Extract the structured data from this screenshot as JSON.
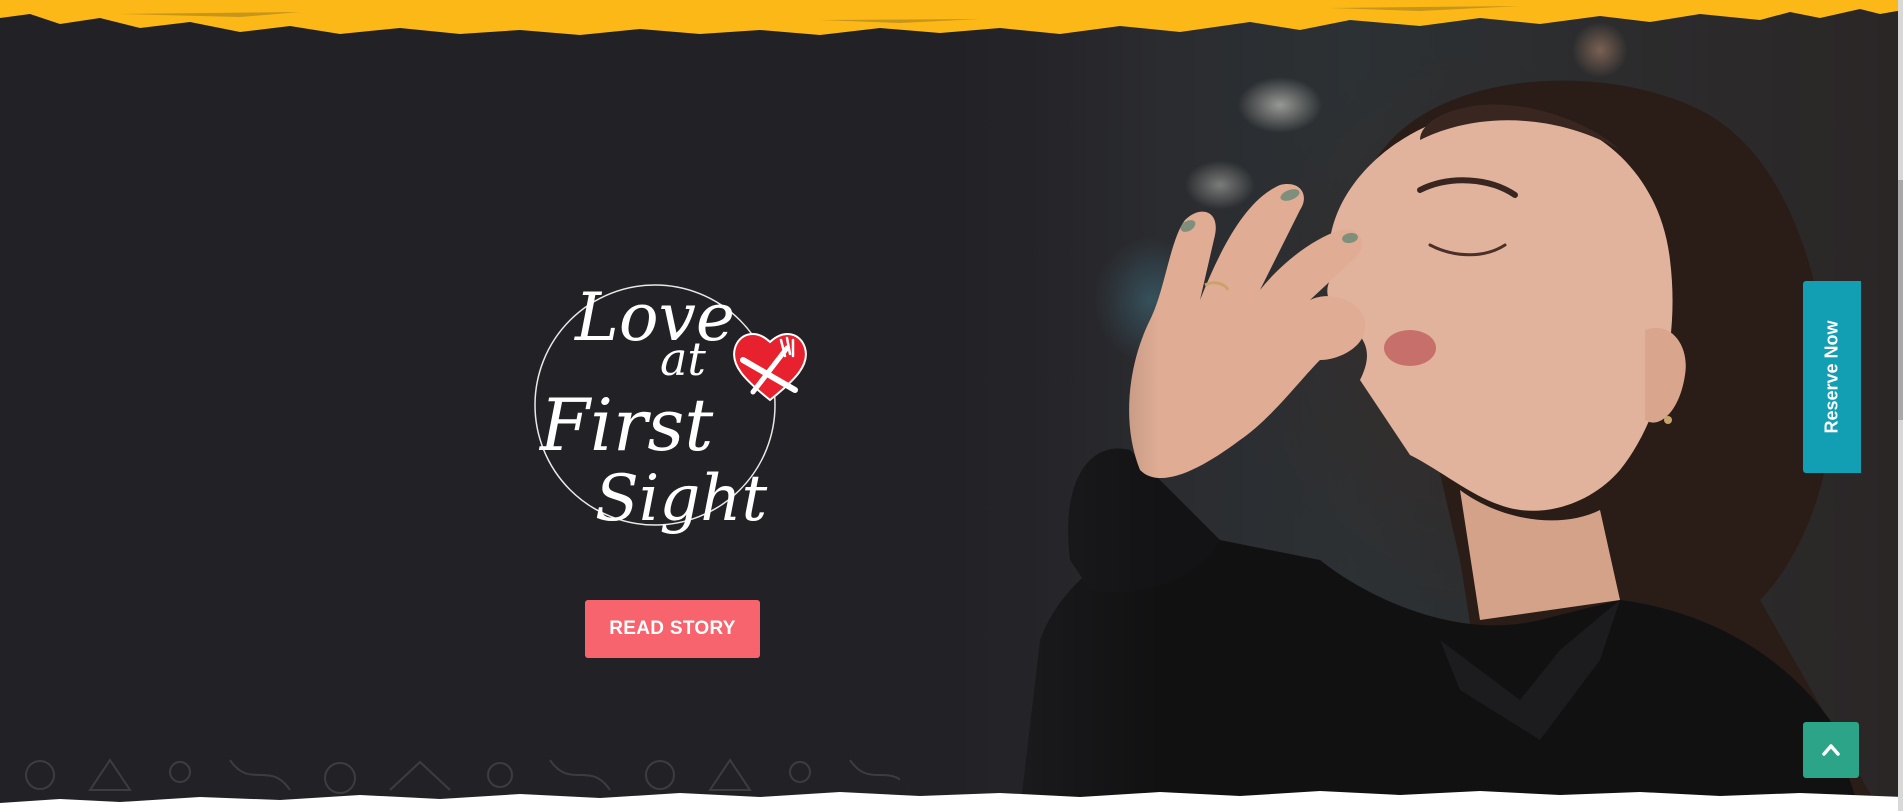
{
  "hero": {
    "logo": {
      "line1": "Love",
      "line2": "at",
      "line3": "First",
      "line4": "Sight",
      "icon": "heart-fork-knife-icon"
    },
    "read_story_label": "READ STORY"
  },
  "side": {
    "reserve_label": "Reserve Now",
    "back_to_top_icon": "chevron-up-icon"
  },
  "colors": {
    "band_yellow": "#fbb817",
    "background": "#222226",
    "button_coral": "#f7646e",
    "reserve_teal": "#139fb3",
    "back_top_green": "#2ba488",
    "heart_red": "#e8212e"
  }
}
